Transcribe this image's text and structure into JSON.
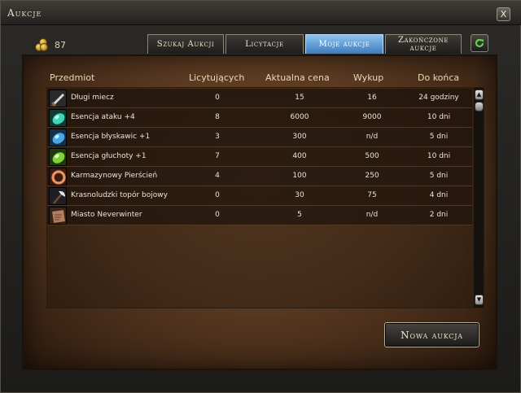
{
  "window": {
    "title": "Aukcje",
    "close_label": "X"
  },
  "player": {
    "gold": "87"
  },
  "tabs": [
    {
      "label": "Szukaj Aukcji",
      "active": false
    },
    {
      "label": "Licytacje",
      "active": false
    },
    {
      "label": "Moje aukcje",
      "active": true
    },
    {
      "label": "Zakończone aukcje",
      "active": false
    }
  ],
  "columns": [
    "Przedmiot",
    "Licytujących",
    "Aktualna cena",
    "Wykup",
    "Do końca"
  ],
  "rows": [
    {
      "icon": "sword-icon",
      "name": "Długi miecz",
      "bidders": "0",
      "price": "15",
      "buyout": "16",
      "remaining": "24 godziny"
    },
    {
      "icon": "teal-gem-icon",
      "name": "Esencja ataku +4",
      "bidders": "8",
      "price": "6000",
      "buyout": "9000",
      "remaining": "10 dni"
    },
    {
      "icon": "blue-gem-icon",
      "name": "Esencja błyskawic +1",
      "bidders": "3",
      "price": "300",
      "buyout": "n/d",
      "remaining": "5 dni"
    },
    {
      "icon": "green-gem-icon",
      "name": "Esencja głuchoty +1",
      "bidders": "7",
      "price": "400",
      "buyout": "500",
      "remaining": "10 dni"
    },
    {
      "icon": "ring-icon",
      "name": "Karmazynowy Pierścień",
      "bidders": "4",
      "price": "100",
      "buyout": "250",
      "remaining": "5 dni"
    },
    {
      "icon": "axe-icon",
      "name": "Krasnoludzki topór bojowy",
      "bidders": "0",
      "price": "30",
      "buyout": "75",
      "remaining": "4 dni"
    },
    {
      "icon": "map-icon",
      "name": "Miasto Neverwinter",
      "bidders": "0",
      "price": "5",
      "buyout": "n/d",
      "remaining": "2 dni"
    }
  ],
  "actions": {
    "new_auction": "Nowa aukcja"
  },
  "colors": {
    "active_tab": "#3b7bbf",
    "parchment": "#5a3a22",
    "row_text": "#ece4d2"
  }
}
